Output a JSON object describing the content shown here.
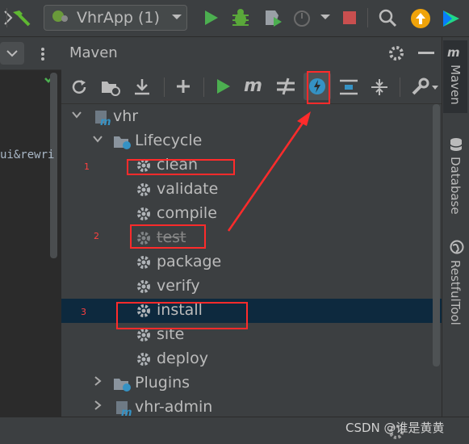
{
  "toolbar": {
    "run_config_label": "VhrApp (1)"
  },
  "editor": {
    "snippet": "ui&rewri"
  },
  "maven": {
    "title": "Maven",
    "tree": [
      {
        "label": "vhr",
        "kind": "project",
        "chevron": "down"
      },
      {
        "label": "Lifecycle",
        "kind": "folder",
        "chevron": "down"
      },
      {
        "label": "clean",
        "kind": "goal",
        "marker": "1"
      },
      {
        "label": "validate",
        "kind": "goal"
      },
      {
        "label": "compile",
        "kind": "goal"
      },
      {
        "label": "test",
        "kind": "goal",
        "skipped": true,
        "marker": "2"
      },
      {
        "label": "package",
        "kind": "goal"
      },
      {
        "label": "verify",
        "kind": "goal"
      },
      {
        "label": "install",
        "kind": "goal",
        "selected": true,
        "marker": "3"
      },
      {
        "label": "site",
        "kind": "goal"
      },
      {
        "label": "deploy",
        "kind": "goal"
      },
      {
        "label": "Plugins",
        "kind": "folder",
        "chevron": "right"
      },
      {
        "label": "vhr-admin",
        "kind": "project",
        "chevron": "right"
      }
    ]
  },
  "right_tabs": {
    "maven": "Maven",
    "database": "Database",
    "restful": "RestfulTool"
  },
  "watermark": "CSDN @谁是黄黄",
  "colors": {
    "run_green": "#4caf50",
    "stop_red": "#c94f4f",
    "annotation_red": "#ff2b2b",
    "selection": "#0d293e",
    "maven_blue": "#3592c4"
  }
}
